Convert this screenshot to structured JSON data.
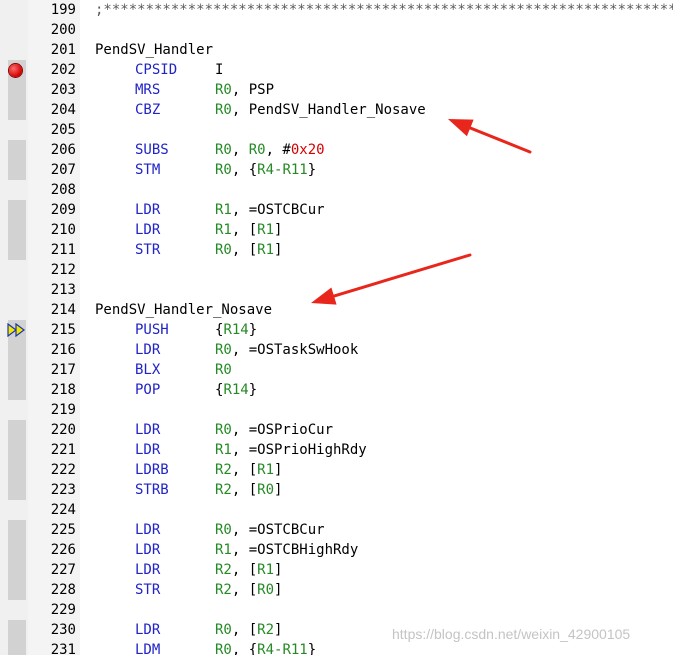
{
  "colors": {
    "opcode": "#1f23c8",
    "register": "#258a25",
    "immediate": "#d60000",
    "comment": "#5a5a5a",
    "annotation_arrow": "#e8261c"
  },
  "gutter": {
    "breakpoint_line": "202",
    "current_line": "215",
    "breakpoint_icon": "breakpoint-dot-icon",
    "current_icon": "execution-pointer-icon"
  },
  "lines": [
    {
      "no": "199",
      "kind": "comment",
      "text": ";**********************************************************************************************"
    },
    {
      "no": "200",
      "kind": "blank"
    },
    {
      "no": "201",
      "kind": "label",
      "text": "PendSV_Handler"
    },
    {
      "no": "202",
      "kind": "instr",
      "op": "CPSID",
      "ops": [
        {
          "t": "sym",
          "v": "I"
        }
      ]
    },
    {
      "no": "203",
      "kind": "instr",
      "op": "MRS",
      "ops": [
        {
          "t": "reg",
          "v": "R0"
        },
        {
          "t": "sym",
          "v": ", PSP"
        }
      ]
    },
    {
      "no": "204",
      "kind": "instr",
      "op": "CBZ",
      "ops": [
        {
          "t": "reg",
          "v": "R0"
        },
        {
          "t": "sym",
          "v": ", PendSV_Handler_Nosave"
        }
      ]
    },
    {
      "no": "205",
      "kind": "blank"
    },
    {
      "no": "206",
      "kind": "instr",
      "op": "SUBS",
      "ops": [
        {
          "t": "reg",
          "v": "R0"
        },
        {
          "t": "sym",
          "v": ", "
        },
        {
          "t": "reg",
          "v": "R0"
        },
        {
          "t": "sym",
          "v": ", #"
        },
        {
          "t": "num",
          "v": "0x20"
        }
      ]
    },
    {
      "no": "207",
      "kind": "instr",
      "op": "STM",
      "ops": [
        {
          "t": "reg",
          "v": "R0"
        },
        {
          "t": "sym",
          "v": ", {"
        },
        {
          "t": "reg",
          "v": "R4-R11"
        },
        {
          "t": "sym",
          "v": "}"
        }
      ]
    },
    {
      "no": "208",
      "kind": "blank"
    },
    {
      "no": "209",
      "kind": "instr",
      "op": "LDR",
      "ops": [
        {
          "t": "reg",
          "v": "R1"
        },
        {
          "t": "sym",
          "v": ", =OSTCBCur"
        }
      ]
    },
    {
      "no": "210",
      "kind": "instr",
      "op": "LDR",
      "ops": [
        {
          "t": "reg",
          "v": "R1"
        },
        {
          "t": "sym",
          "v": ", ["
        },
        {
          "t": "reg",
          "v": "R1"
        },
        {
          "t": "sym",
          "v": "]"
        }
      ]
    },
    {
      "no": "211",
      "kind": "instr",
      "op": "STR",
      "ops": [
        {
          "t": "reg",
          "v": "R0"
        },
        {
          "t": "sym",
          "v": ", ["
        },
        {
          "t": "reg",
          "v": "R1"
        },
        {
          "t": "sym",
          "v": "]"
        }
      ]
    },
    {
      "no": "212",
      "kind": "blank"
    },
    {
      "no": "213",
      "kind": "blank"
    },
    {
      "no": "214",
      "kind": "label",
      "text": "PendSV_Handler_Nosave"
    },
    {
      "no": "215",
      "kind": "instr",
      "op": "PUSH",
      "ops": [
        {
          "t": "sym",
          "v": "{"
        },
        {
          "t": "reg",
          "v": "R14"
        },
        {
          "t": "sym",
          "v": "}"
        }
      ]
    },
    {
      "no": "216",
      "kind": "instr",
      "op": "LDR",
      "ops": [
        {
          "t": "reg",
          "v": "R0"
        },
        {
          "t": "sym",
          "v": ", =OSTaskSwHook"
        }
      ]
    },
    {
      "no": "217",
      "kind": "instr",
      "op": "BLX",
      "ops": [
        {
          "t": "reg",
          "v": "R0"
        }
      ]
    },
    {
      "no": "218",
      "kind": "instr",
      "op": "POP",
      "ops": [
        {
          "t": "sym",
          "v": "{"
        },
        {
          "t": "reg",
          "v": "R14"
        },
        {
          "t": "sym",
          "v": "}"
        }
      ]
    },
    {
      "no": "219",
      "kind": "blank"
    },
    {
      "no": "220",
      "kind": "instr",
      "op": "LDR",
      "ops": [
        {
          "t": "reg",
          "v": "R0"
        },
        {
          "t": "sym",
          "v": ", =OSPrioCur"
        }
      ]
    },
    {
      "no": "221",
      "kind": "instr",
      "op": "LDR",
      "ops": [
        {
          "t": "reg",
          "v": "R1"
        },
        {
          "t": "sym",
          "v": ", =OSPrioHighRdy"
        }
      ]
    },
    {
      "no": "222",
      "kind": "instr",
      "op": "LDRB",
      "ops": [
        {
          "t": "reg",
          "v": "R2"
        },
        {
          "t": "sym",
          "v": ", ["
        },
        {
          "t": "reg",
          "v": "R1"
        },
        {
          "t": "sym",
          "v": "]"
        }
      ]
    },
    {
      "no": "223",
      "kind": "instr",
      "op": "STRB",
      "ops": [
        {
          "t": "reg",
          "v": "R2"
        },
        {
          "t": "sym",
          "v": ", ["
        },
        {
          "t": "reg",
          "v": "R0"
        },
        {
          "t": "sym",
          "v": "]"
        }
      ]
    },
    {
      "no": "224",
      "kind": "blank"
    },
    {
      "no": "225",
      "kind": "instr",
      "op": "LDR",
      "ops": [
        {
          "t": "reg",
          "v": "R0"
        },
        {
          "t": "sym",
          "v": ", =OSTCBCur"
        }
      ]
    },
    {
      "no": "226",
      "kind": "instr",
      "op": "LDR",
      "ops": [
        {
          "t": "reg",
          "v": "R1"
        },
        {
          "t": "sym",
          "v": ", =OSTCBHighRdy"
        }
      ]
    },
    {
      "no": "227",
      "kind": "instr",
      "op": "LDR",
      "ops": [
        {
          "t": "reg",
          "v": "R2"
        },
        {
          "t": "sym",
          "v": ", ["
        },
        {
          "t": "reg",
          "v": "R1"
        },
        {
          "t": "sym",
          "v": "]"
        }
      ]
    },
    {
      "no": "228",
      "kind": "instr",
      "op": "STR",
      "ops": [
        {
          "t": "reg",
          "v": "R2"
        },
        {
          "t": "sym",
          "v": ", ["
        },
        {
          "t": "reg",
          "v": "R0"
        },
        {
          "t": "sym",
          "v": "]"
        }
      ]
    },
    {
      "no": "229",
      "kind": "blank"
    },
    {
      "no": "230",
      "kind": "instr",
      "op": "LDR",
      "ops": [
        {
          "t": "reg",
          "v": "R0"
        },
        {
          "t": "sym",
          "v": ", ["
        },
        {
          "t": "reg",
          "v": "R2"
        },
        {
          "t": "sym",
          "v": "]"
        }
      ]
    },
    {
      "no": "231",
      "kind": "instr",
      "op": "LDM",
      "ops": [
        {
          "t": "reg",
          "v": "R0"
        },
        {
          "t": "sym",
          "v": ", {"
        },
        {
          "t": "reg",
          "v": "R4-R11"
        },
        {
          "t": "sym",
          "v": "}"
        }
      ]
    }
  ],
  "annotations": [
    {
      "icon": "red-arrow-icon",
      "points_to_line": "204"
    },
    {
      "icon": "red-arrow-icon",
      "points_to_line": "214"
    }
  ],
  "watermark": "https://blog.csdn.net/weixin_42900105"
}
